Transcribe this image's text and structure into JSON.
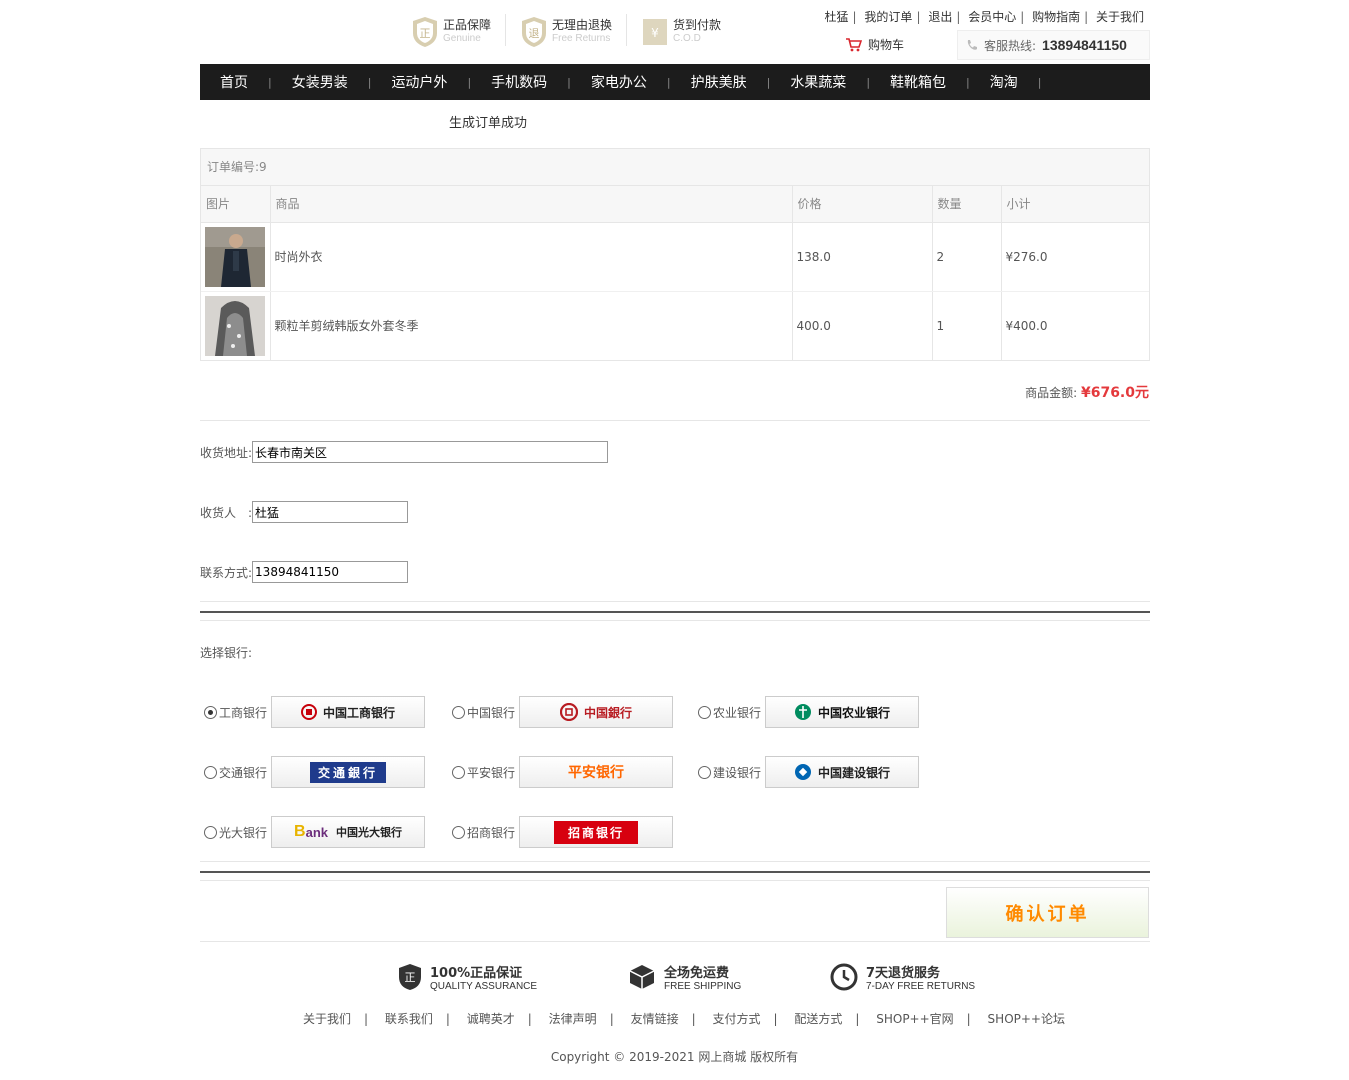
{
  "header": {
    "badges": [
      {
        "cn": "正品保障",
        "en": "Genuine",
        "glyph": "正"
      },
      {
        "cn": "无理由退换",
        "en": "Free Returns",
        "glyph": "退"
      },
      {
        "cn": "货到付款",
        "en": "C.O.D",
        "glyph": "¥"
      }
    ],
    "top_links": [
      "杜猛",
      "我的订单",
      "退出",
      "会员中心",
      "购物指南",
      "关于我们"
    ],
    "cart_label": "购物车",
    "hotline_label": "客服热线:",
    "hotline_number": "13894841150"
  },
  "nav": [
    "首页",
    "女装男装",
    "运动户外",
    "手机数码",
    "家电办公",
    "护肤美肤",
    "水果蔬菜",
    "鞋靴箱包",
    "淘淘"
  ],
  "success_message": "生成订单成功",
  "order": {
    "number_label": "订单编号:9",
    "columns": [
      "图片",
      "商品",
      "价格",
      "数量",
      "小计"
    ],
    "rows": [
      {
        "name": "时尚外衣",
        "price": "138.0",
        "qty": "2",
        "subtotal": "¥276.0"
      },
      {
        "name": "颗粒羊剪绒韩版女外套冬季",
        "price": "400.0",
        "qty": "1",
        "subtotal": "¥400.0"
      }
    ],
    "total_label": "商品金额: ",
    "total_value": "¥676.0元"
  },
  "form": {
    "address_label": "收货地址:",
    "address_value": "长春市南关区",
    "receiver_label": "收货人　:",
    "receiver_value": "杜猛",
    "phone_label": "联系方式:",
    "phone_value": "13894841150"
  },
  "bank_section_label": "选择银行:",
  "banks": [
    {
      "label": "工商银行",
      "logo": "中国工商银行",
      "color": "#c7000b",
      "selected": true
    },
    {
      "label": "中国银行",
      "logo": "中国銀行",
      "color": "#b81c22",
      "selected": false
    },
    {
      "label": "农业银行",
      "logo": "中国农业银行",
      "color": "#008c5f",
      "selected": false
    },
    {
      "label": "交通银行",
      "logo": "交通銀行",
      "color": "#1f3b8c",
      "selected": false
    },
    {
      "label": "平安银行",
      "logo": "平安银行",
      "color": "#ff6600",
      "selected": false
    },
    {
      "label": "建设银行",
      "logo": "中国建设银行",
      "color": "#0066b3",
      "selected": false
    },
    {
      "label": "光大银行",
      "logo": "中国光大银行",
      "color": "#6b2d7b",
      "selected": false
    },
    {
      "label": "招商银行",
      "logo": "招商银行",
      "color": "#d7000f",
      "selected": false
    }
  ],
  "confirm_label": "确认订单",
  "guarantees": [
    {
      "t1": "100%正品保证",
      "t2": "QUALITY ASSURANCE",
      "icon": "正"
    },
    {
      "t1": "全场免运费",
      "t2": "FREE SHIPPING",
      "icon": "box"
    },
    {
      "t1": "7天退货服务",
      "t2": "7-DAY FREE RETURNS",
      "icon": "clock"
    }
  ],
  "footer_links": [
    "关于我们",
    "联系我们",
    "诚聘英才",
    "法律声明",
    "友情链接",
    "支付方式",
    "配送方式",
    "SHOP++官网",
    "SHOP++论坛"
  ],
  "copyright": "Copyright © 2019-2021 网上商城 版权所有"
}
